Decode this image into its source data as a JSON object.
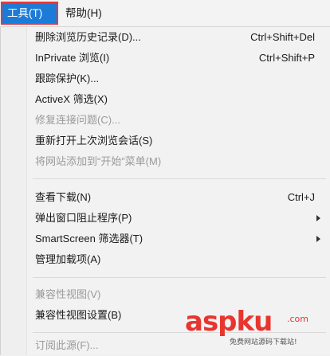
{
  "menubar": {
    "tools": "工具(T)",
    "help": "帮助(H)"
  },
  "menu": {
    "items": [
      {
        "label": "删除浏览历史记录(D)...",
        "shortcut": "Ctrl+Shift+Del"
      },
      {
        "label": "InPrivate 浏览(I)",
        "shortcut": "Ctrl+Shift+P"
      },
      {
        "label": "跟踪保护(K)..."
      },
      {
        "label": "ActiveX 筛选(X)"
      },
      {
        "label": "修复连接问题(C)..."
      },
      {
        "label": "重新打开上次浏览会话(S)"
      },
      {
        "label": "将网站添加到“开始”菜单(M)"
      },
      {
        "label": "查看下载(N)",
        "shortcut": "Ctrl+J"
      },
      {
        "label": "弹出窗口阻止程序(P)"
      },
      {
        "label": "SmartScreen 筛选器(T)"
      },
      {
        "label": "管理加载项(A)"
      },
      {
        "label": "兼容性视图(V)"
      },
      {
        "label": "兼容性视图设置(B)"
      },
      {
        "label": "订阅此源(F)..."
      }
    ]
  },
  "watermark": {
    "brand": "aspku",
    "domain": ".com",
    "tagline": "免费网站源码下载站!"
  },
  "colors": {
    "active_tab": "#1d7bd8",
    "highlight_border": "#e23a3a",
    "disabled_text": "#9a9a9a",
    "watermark": "#e8352f"
  }
}
